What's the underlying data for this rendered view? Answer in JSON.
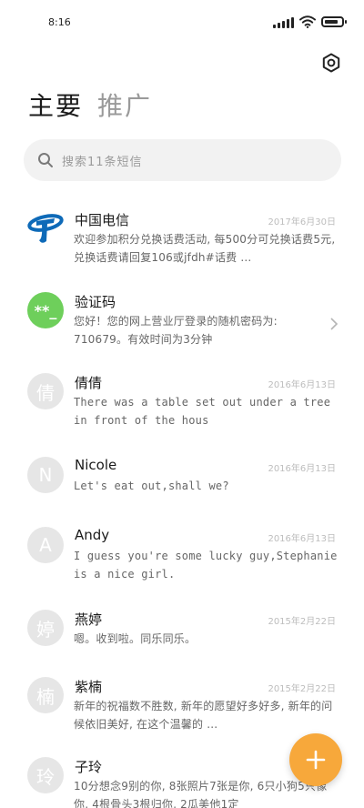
{
  "status": {
    "time": "8:16",
    "battery_level": 0.85
  },
  "header": {
    "tabs": [
      {
        "label": "主要",
        "active": true
      },
      {
        "label": "推广",
        "active": false
      }
    ]
  },
  "search": {
    "placeholder": "搜索11条短信"
  },
  "messages": [
    {
      "sender": "中国电信",
      "date": "2017年6月30日",
      "preview": "欢迎参加积分兑换话费活动, 每500分可兑换话费5元, 兑换话费请回复106或jfdh#话费 ...",
      "avatar_text": "",
      "avatar_kind": "telecom"
    },
    {
      "sender": "验证码",
      "date": "",
      "preview": "您好！您的网上营业厅登录的随机密码为: 710679。有效时间为3分钟",
      "avatar_text": "**_",
      "avatar_kind": "green"
    },
    {
      "sender": "倩倩",
      "date": "2016年6月13日",
      "preview": "There was a table set out under a tree in front of the hous",
      "avatar_text": "倩",
      "avatar_kind": "gray"
    },
    {
      "sender": "Nicole",
      "date": "2016年6月13日",
      "preview": "Let's eat out,shall we?",
      "avatar_text": "N",
      "avatar_kind": "gray"
    },
    {
      "sender": "Andy",
      "date": "2016年6月13日",
      "preview": "I guess you're some lucky guy,Stephanie is a nice girl.",
      "avatar_text": "A",
      "avatar_kind": "gray"
    },
    {
      "sender": "燕婷",
      "date": "2015年2月22日",
      "preview": "嗯。收到啦。同乐同乐。",
      "avatar_text": "婷",
      "avatar_kind": "gray"
    },
    {
      "sender": "紫楠",
      "date": "2015年2月22日",
      "preview": "新年的祝福数不胜数, 新年的愿望好多好多, 新年的问候依旧美好, 在这个温馨的 ...",
      "avatar_text": "楠",
      "avatar_kind": "gray"
    },
    {
      "sender": "子玲",
      "date": "2015",
      "preview": "10分想念9别的你, 8张照片7张是你, 6只小狗5只像你, 4根骨头3根归你, 2瓜美他1定",
      "avatar_text": "玲",
      "avatar_kind": "gray"
    }
  ],
  "fab": {
    "label": "+"
  },
  "colors": {
    "accent": "#f7a83b",
    "verify_avatar": "#6ecf5b",
    "telecom_blue": "#0e6ab8"
  }
}
